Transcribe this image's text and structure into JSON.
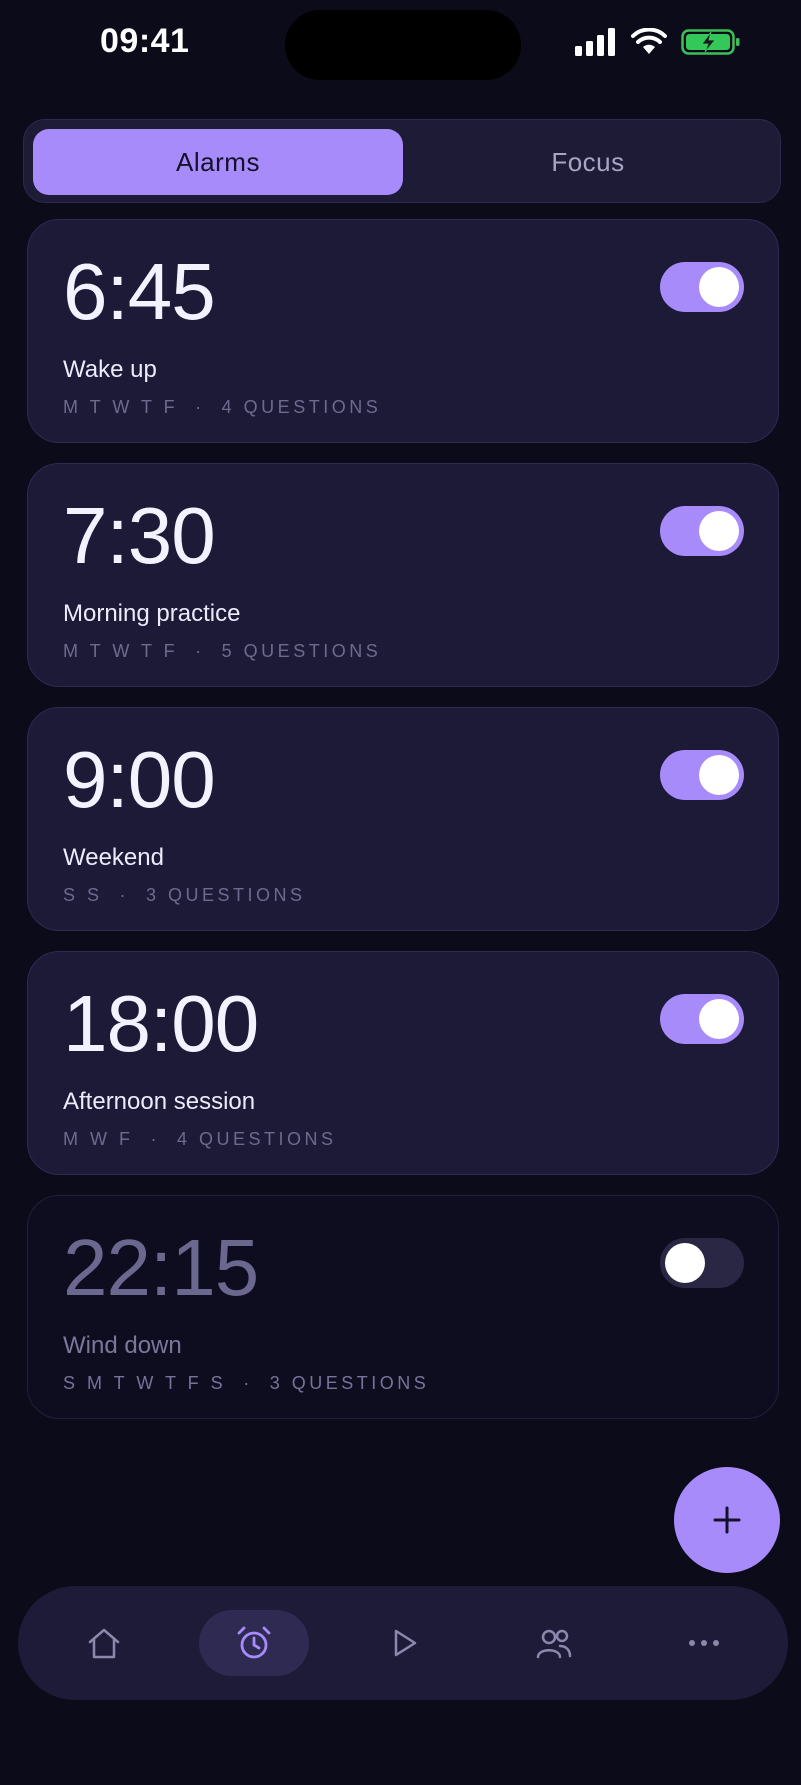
{
  "status_bar": {
    "time": "09:41"
  },
  "segments": {
    "alarms": "Alarms",
    "focus": "Focus"
  },
  "alarms": [
    {
      "time": "6:45",
      "label": "Wake up",
      "days": "M T W T F",
      "questions": "4 QUESTIONS",
      "enabled": true
    },
    {
      "time": "7:30",
      "label": "Morning practice",
      "days": "M T W T F",
      "questions": "5 QUESTIONS",
      "enabled": true
    },
    {
      "time": "9:00",
      "label": "Weekend",
      "days": "S S",
      "questions": "3 QUESTIONS",
      "enabled": true
    },
    {
      "time": "18:00",
      "label": "Afternoon session",
      "days": "M W F",
      "questions": "4 QUESTIONS",
      "enabled": true
    },
    {
      "time": "22:15",
      "label": "Wind down",
      "days": "S M T W T F S",
      "questions": "3 QUESTIONS",
      "enabled": false
    }
  ],
  "fab": {
    "icon": "plus-icon"
  },
  "tabbar": [
    {
      "icon": "home-icon",
      "active": false
    },
    {
      "icon": "alarm-clock-icon",
      "active": true
    },
    {
      "icon": "play-icon",
      "active": false
    },
    {
      "icon": "people-icon",
      "active": false
    },
    {
      "icon": "more-icon",
      "active": false
    }
  ],
  "colors": {
    "accent": "#a78bfa",
    "background": "#0c0b1a",
    "card": "#1d1a38"
  }
}
